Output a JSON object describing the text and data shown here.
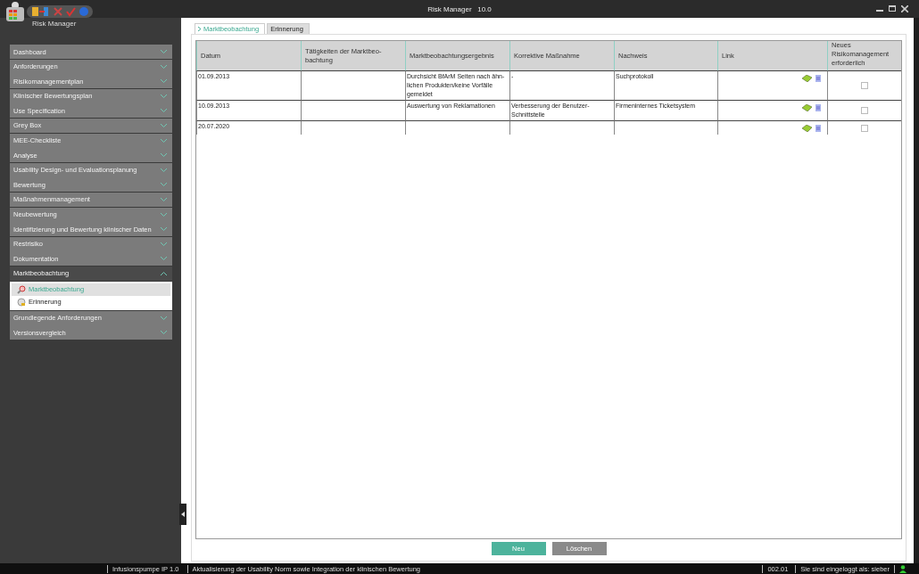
{
  "window": {
    "title": "Risk Manager   10.0"
  },
  "app": {
    "name": "Risk Manager"
  },
  "sidebar": {
    "items": [
      {
        "label": "Dashboard",
        "expanded": false
      },
      {
        "label": "Anforderungen",
        "expanded": false
      },
      {
        "label": "Risikomanagementplan",
        "expanded": false
      },
      {
        "label": "Klinischer Bewertungsplan",
        "expanded": false
      },
      {
        "label": "Use Specification",
        "expanded": false
      },
      {
        "label": "Grey Box",
        "expanded": false
      },
      {
        "label": "MEE-Checkliste",
        "expanded": false
      },
      {
        "label": "Analyse",
        "expanded": false
      },
      {
        "label": "Usability Design- und Evaluationsplanung",
        "expanded": false
      },
      {
        "label": "Bewertung",
        "expanded": false
      },
      {
        "label": "Maßnahmenmanagement",
        "expanded": false
      },
      {
        "label": "Neubewertung",
        "expanded": false
      },
      {
        "label": "Identifizierung und Bewertung klinischer Daten",
        "expanded": false
      },
      {
        "label": "Restrisiko",
        "expanded": false
      },
      {
        "label": "Dokumentation",
        "expanded": false
      },
      {
        "label": "Marktbeobachtung",
        "expanded": true,
        "children": [
          {
            "label": "Marktbeobachtung",
            "selected": true
          },
          {
            "label": "Erinnerung",
            "selected": false
          }
        ]
      },
      {
        "label": "Grundlegende Anforderungen",
        "expanded": false
      },
      {
        "label": "Versionsvergleich",
        "expanded": false
      }
    ]
  },
  "tabs": [
    {
      "label": "Marktbeobachtung",
      "selected": true
    },
    {
      "label": "Erinnerung",
      "selected": false
    }
  ],
  "table": {
    "columns": [
      [
        "Datum"
      ],
      [
        "Tätigkeiten der Marktbeo-",
        "bachtung"
      ],
      [
        "Marktbeobachtungsergebnis"
      ],
      [
        "Korrektive Maßnahme"
      ],
      [
        "Nachweis"
      ],
      [
        "Link"
      ],
      [
        "Neues",
        "Risikomanagement",
        "erforderlich"
      ]
    ],
    "rows": [
      {
        "datum": "01.09.2013",
        "taetigkeiten": [],
        "ergebnis": [
          "Durchsicht BfArM Seiten nach ähn-",
          "lichen Produkten/keine Vorfälle",
          "gemeldet"
        ],
        "massnahme": [
          "-"
        ],
        "nachweis": [
          "Suchprotokoll"
        ],
        "checked": false
      },
      {
        "datum": "10.09.2013",
        "taetigkeiten": [],
        "ergebnis": [
          "Auswertung von Reklamationen"
        ],
        "massnahme": [
          "Verbesserung der Benutzer-",
          "Schnittstelle"
        ],
        "nachweis": [
          "Firmeninternes Ticketsystem"
        ],
        "checked": false
      },
      {
        "datum": "20.07.2020",
        "taetigkeiten": [],
        "ergebnis": [],
        "massnahme": [],
        "nachweis": [],
        "checked": false
      }
    ]
  },
  "buttons": [
    {
      "label": "Neu",
      "kind": "primary"
    },
    {
      "label": "Löschen",
      "kind": "secondary"
    }
  ],
  "status_bar": {
    "project": "Infusionspumpe IP 1.0",
    "description": "Aktualisierung der Usability Norm sowie Integration der klinischen Bewertung",
    "version": "002.01",
    "user": "Sie sind eingeloggt als: sieber"
  }
}
